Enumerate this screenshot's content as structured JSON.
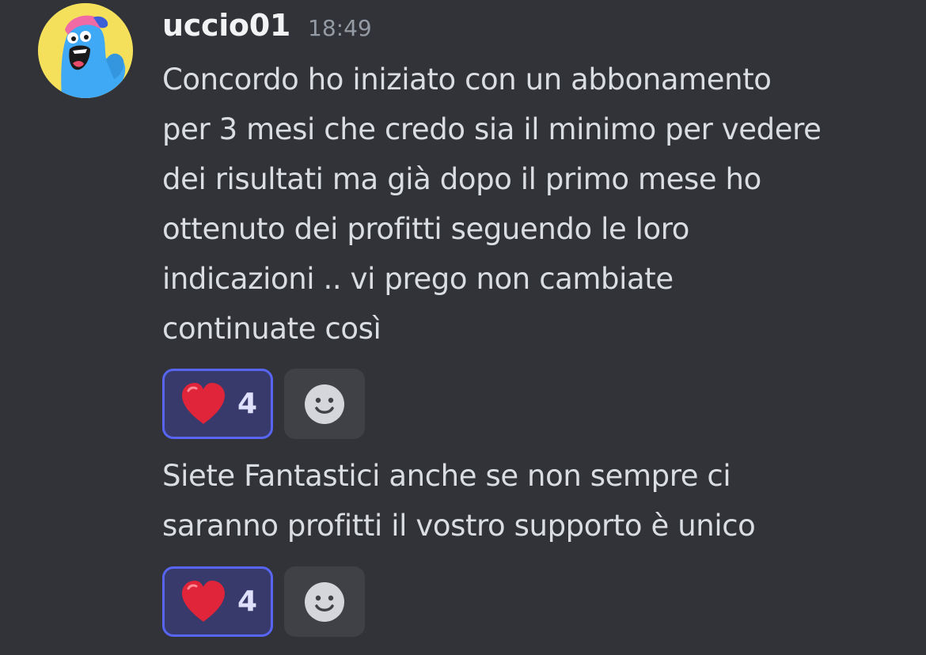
{
  "author": {
    "username": "uccio01",
    "timestamp": "18:49",
    "avatar_icon": "blue-monster-avatar",
    "avatar_bg": "#f5e05c"
  },
  "messages": [
    {
      "text": "Concordo ho iniziato con un abbonamento\nper 3 mesi che credo sia il minimo per vedere\ndei risultati ma già dopo il primo mese ho\nottenuto dei profitti seguendo le loro\nindicazioni .. vi prego non cambiate\ncontinuate così",
      "reactions": [
        {
          "emoji": "heart-emoji",
          "count": "4"
        }
      ],
      "add_reaction_icon": "add-reaction-smiley-icon"
    },
    {
      "text": "Siete Fantastici anche se non sempre ci\nsaranno profitti il vostro supporto è unico",
      "reactions": [
        {
          "emoji": "heart-emoji",
          "count": "4"
        }
      ],
      "add_reaction_icon": "add-reaction-smiley-icon"
    }
  ],
  "colors": {
    "background": "#313338",
    "username": "#f2f3f5",
    "timestamp": "#949ba4",
    "message_text": "#dbdee1",
    "reaction_border": "#5865f2",
    "reaction_bg": "#373a6b",
    "heart": "#e0243a"
  }
}
